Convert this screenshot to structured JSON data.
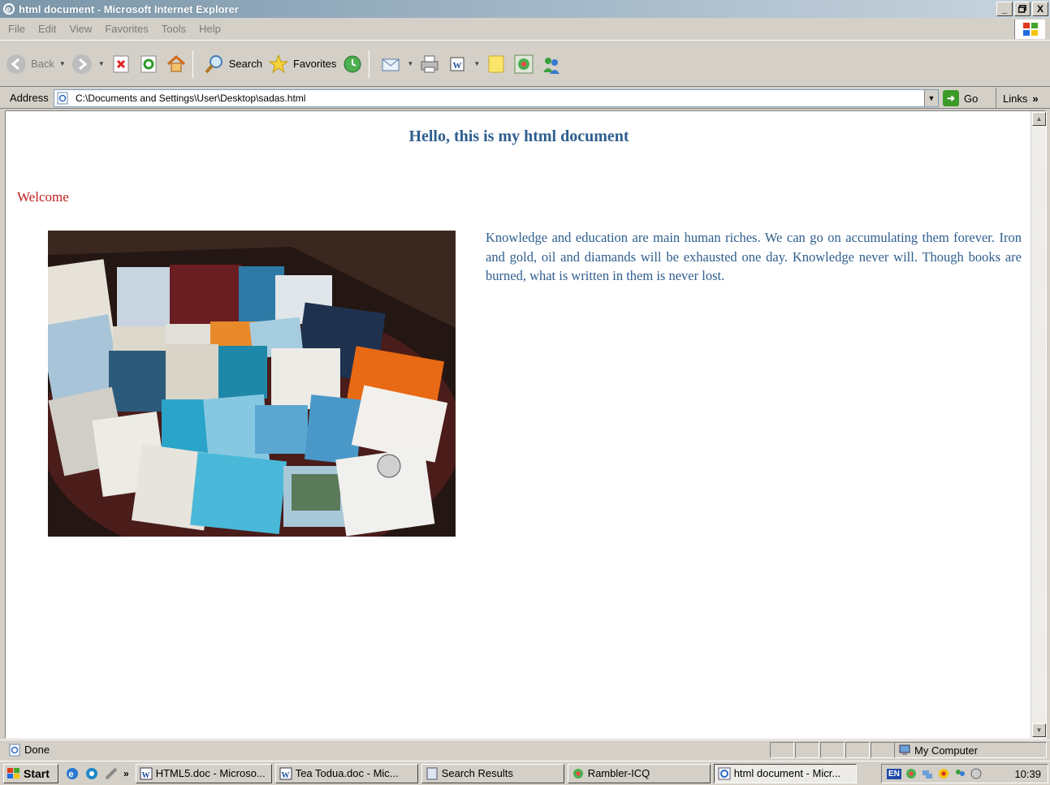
{
  "window": {
    "title": "html document - Microsoft Internet Explorer",
    "controls": [
      "_",
      " ",
      "X"
    ]
  },
  "menu": [
    "File",
    "Edit",
    "View",
    "Favorites",
    "Tools",
    "Help"
  ],
  "toolbar": {
    "back_label": "Back",
    "search_label": "Search",
    "favorites_label": "Favorites",
    "icons": [
      "back-icon",
      "forward-icon",
      "stop-icon",
      "refresh-icon",
      "home-icon",
      "search-icon",
      "favorites-star-icon",
      "history-icon",
      "mail-icon",
      "print-icon",
      "word-edit-icon",
      "notes-icon",
      "icq-icon",
      "messenger-icon"
    ]
  },
  "address": {
    "label": "Address",
    "url": "C:\\Documents and Settings\\User\\Desktop\\sadas.html",
    "go_label": "Go",
    "links_label": "Links"
  },
  "content": {
    "heading": "Hello, this is my html document",
    "welcome": "Welcome",
    "paragraph": "Knowledge and education are main human riches. We can go on accumulating them forever. Iron and gold, oil and diamands will be exhausted one day. Knowledge never will. Though books are burned, what is written in them is never lost.",
    "image_subject": "books-on-table-photo"
  },
  "status": {
    "text": "Done",
    "zone": "My Computer"
  },
  "taskbar": {
    "start_label": "start",
    "tasks": [
      {
        "label": "HTML5.doc - Microso...",
        "icon": "word-icon",
        "active": false
      },
      {
        "label": "Tea Todua.doc - Mic...",
        "icon": "word-icon",
        "active": false
      },
      {
        "label": "Search Results",
        "icon": "search-window-icon",
        "active": false
      },
      {
        "label": "Rambler-ICQ",
        "icon": "icq-icon",
        "active": false
      },
      {
        "label": "html document - Micr...",
        "icon": "ie-icon",
        "active": true
      }
    ],
    "tray_lang": "EN",
    "clock": "10:39"
  },
  "colors": {
    "heading": "#2f5e8e",
    "welcome": "#c02020",
    "paragraph": "#2f5e8e"
  }
}
